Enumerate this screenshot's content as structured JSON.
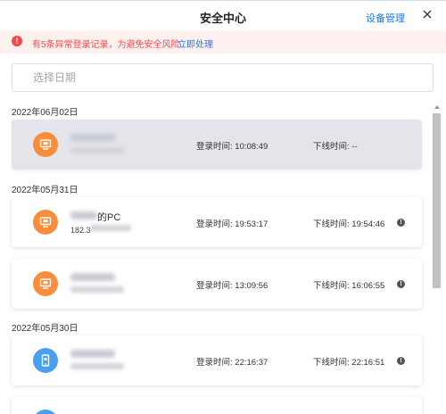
{
  "header": {
    "title": "安全中心",
    "device_link": "设备管理",
    "close_icon": "close-icon"
  },
  "alert": {
    "icon": "exclamation-icon",
    "text": "有5条异常登录记录，为避免安全风险",
    "link": "立即处理",
    "color": "#f5484a"
  },
  "date_filter": {
    "placeholder": "选择日期"
  },
  "login_label": "登录时间: ",
  "logout_label": "下线时间: ",
  "groups": [
    {
      "date": "2022年06月02日"
    },
    {
      "date": "2022年05月31日"
    },
    {
      "date": "2022年05月30日"
    }
  ],
  "records": [
    {
      "device": "pc",
      "name_visible": "",
      "ip_visible": "",
      "login_time": "10:08:49",
      "logout_time": "--",
      "selected": true,
      "warning": false
    },
    {
      "device": "pc",
      "name_visible": "的PC",
      "ip_visible": "182.3",
      "login_time": "19:53:17",
      "logout_time": "19:54:46",
      "selected": false,
      "warning": true
    },
    {
      "device": "pc",
      "name_visible": "",
      "ip_visible": "",
      "login_time": "13:09:56",
      "logout_time": "16:06:55",
      "selected": false,
      "warning": true
    },
    {
      "device": "mobile",
      "name_visible": "",
      "ip_visible": "",
      "login_time": "22:16:37",
      "logout_time": "22:16:51",
      "selected": false,
      "warning": true
    }
  ],
  "colors": {
    "accent": "#1677ff",
    "pc_icon": "#fa8d3b",
    "mobile_icon": "#4a9ff1",
    "selected_row": "#e3e5ea"
  }
}
